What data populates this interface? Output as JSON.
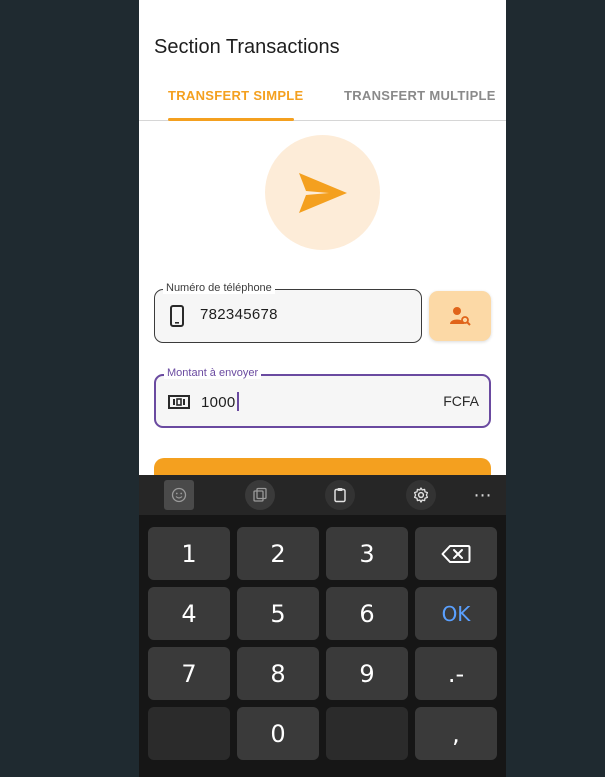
{
  "page": {
    "title": "Section Transactions"
  },
  "tabs": [
    {
      "label": "TRANSFERT SIMPLE",
      "active": true
    },
    {
      "label": "TRANSFERT MULTIPLE",
      "active": false
    }
  ],
  "icons": {
    "send": "send-icon",
    "phone": "smartphone-icon",
    "contact_search": "contact-search-icon",
    "money": "money-icon"
  },
  "form": {
    "phone_field": {
      "label": "Numéro de téléphone",
      "value": "782345678"
    },
    "amount_field": {
      "label": "Montant à envoyer",
      "value": "1000",
      "suffix": "FCFA"
    }
  },
  "keyboard": {
    "toolbar": [
      "emoji-icon",
      "clipboard-icon",
      "keyboard-board-icon",
      "gear-icon",
      "more-icon"
    ],
    "more_label": "⋯",
    "keys": {
      "k1": "1",
      "k2": "2",
      "k3": "3",
      "k4": "4",
      "k5": "5",
      "k6": "6",
      "k7": "7",
      "k8": "8",
      "k9": "9",
      "k0": "0",
      "ok": "OK",
      "dot_dash": ".-",
      "comma": ","
    }
  },
  "colors": {
    "accent": "#f4a01f",
    "accent_light": "#fdecd8",
    "focus": "#6a4aa0",
    "inactive_tab": "#8a8a8a",
    "ok_key": "#5aa0ff",
    "background": "#1f2a30"
  }
}
